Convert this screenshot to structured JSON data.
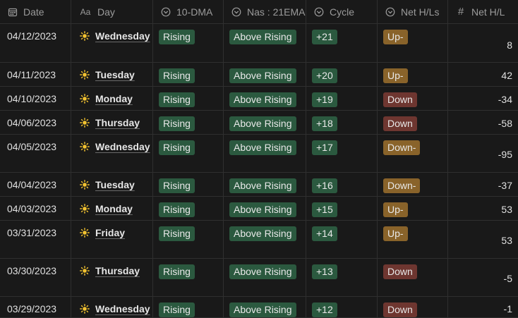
{
  "headers": {
    "date": "Date",
    "day": "Day",
    "dma": "10-DMA",
    "ema": "Nas : 21EMA",
    "cycle": "Cycle",
    "net": "Net H/Ls",
    "num": "Net H/L"
  },
  "colors": {
    "green_tag": "#2b593f",
    "gold_tag": "#89632a",
    "red_tag": "#6e3630",
    "sun": "#f2c230"
  },
  "rows": [
    {
      "date": "04/12/2023",
      "day": "Wednesday",
      "dma": "Rising",
      "ema": "Above Rising",
      "cycle": "+21",
      "net": "Up-",
      "net_color": "gold",
      "num": "8"
    },
    {
      "date": "04/11/2023",
      "day": "Tuesday",
      "dma": "Rising",
      "ema": "Above Rising",
      "cycle": "+20",
      "net": "Up-",
      "net_color": "gold",
      "num": "42"
    },
    {
      "date": "04/10/2023",
      "day": "Monday",
      "dma": "Rising",
      "ema": "Above Rising",
      "cycle": "+19",
      "net": "Down",
      "net_color": "red",
      "num": "-34"
    },
    {
      "date": "04/06/2023",
      "day": "Thursday",
      "dma": "Rising",
      "ema": "Above Rising",
      "cycle": "+18",
      "net": "Down",
      "net_color": "red",
      "num": "-58"
    },
    {
      "date": "04/05/2023",
      "day": "Wednesday",
      "dma": "Rising",
      "ema": "Above Rising",
      "cycle": "+17",
      "net": "Down-",
      "net_color": "gold",
      "num": "-95"
    },
    {
      "date": "04/04/2023",
      "day": "Tuesday",
      "dma": "Rising",
      "ema": "Above Rising",
      "cycle": "+16",
      "net": "Down-",
      "net_color": "gold",
      "num": "-37"
    },
    {
      "date": "04/03/2023",
      "day": "Monday",
      "dma": "Rising",
      "ema": "Above Rising",
      "cycle": "+15",
      "net": "Up-",
      "net_color": "gold",
      "num": "53"
    },
    {
      "date": "03/31/2023",
      "day": "Friday",
      "dma": "Rising",
      "ema": "Above Rising",
      "cycle": "+14",
      "net": "Up-",
      "net_color": "gold",
      "num": "53"
    },
    {
      "date": "03/30/2023",
      "day": "Thursday",
      "dma": "Rising",
      "ema": "Above Rising",
      "cycle": "+13",
      "net": "Down",
      "net_color": "red",
      "num": "-5"
    },
    {
      "date": "03/29/2023",
      "day": "Wednesday",
      "dma": "Rising",
      "ema": "Above Rising",
      "cycle": "+12",
      "net": "Down",
      "net_color": "red",
      "num": "-1"
    }
  ]
}
